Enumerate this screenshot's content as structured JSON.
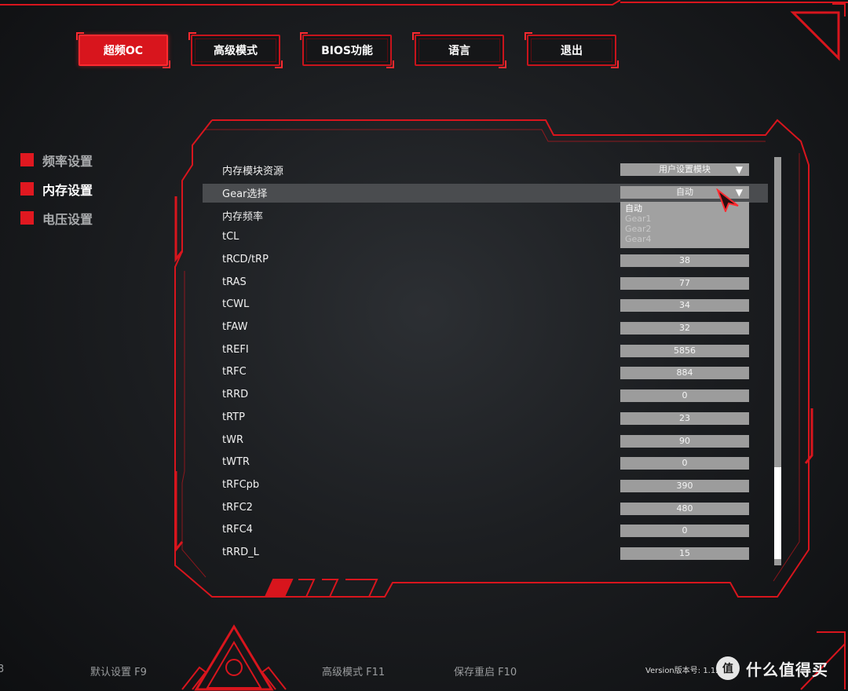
{
  "top_nav": {
    "items": [
      {
        "label": "超频OC",
        "active": true
      },
      {
        "label": "高级模式",
        "active": false
      },
      {
        "label": "BIOS功能",
        "active": false
      },
      {
        "label": "语言",
        "active": false
      },
      {
        "label": "退出",
        "active": false
      }
    ]
  },
  "sidebar": {
    "items": [
      {
        "label": "频率设置",
        "active": false
      },
      {
        "label": "内存设置",
        "active": true
      },
      {
        "label": "电压设置",
        "active": false
      }
    ]
  },
  "settings": {
    "rows": [
      {
        "name": "内存模块资源",
        "value": "用户设置模块",
        "has_dropdown": true
      },
      {
        "name": "Gear选择",
        "value": "自动",
        "has_dropdown": true,
        "highlighted": true
      },
      {
        "name": "内存频率",
        "value": ""
      },
      {
        "name": "tCL",
        "value": ""
      },
      {
        "name": "tRCD/tRP",
        "value": "38"
      },
      {
        "name": "tRAS",
        "value": "77"
      },
      {
        "name": "tCWL",
        "value": "34"
      },
      {
        "name": "tFAW",
        "value": "32"
      },
      {
        "name": "tREFI",
        "value": "5856"
      },
      {
        "name": "tRFC",
        "value": "884"
      },
      {
        "name": "tRRD",
        "value": "0"
      },
      {
        "name": "tRTP",
        "value": "23"
      },
      {
        "name": "tWR",
        "value": "90"
      },
      {
        "name": "tWTR",
        "value": "0"
      },
      {
        "name": "tRFCpb",
        "value": "390"
      },
      {
        "name": "tRFC2",
        "value": "480"
      },
      {
        "name": "tRFC4",
        "value": "0"
      },
      {
        "name": "tRRD_L",
        "value": "15"
      }
    ],
    "gear_dropdown_options": [
      "自动",
      "Gear1",
      "Gear2",
      "Gear4"
    ],
    "gear_selected": "自动"
  },
  "footer": {
    "left_fragment": "3",
    "default_settings": "默认设置 F9",
    "advanced_mode": "高级模式 F11",
    "save_restart": "保存重启 F10",
    "version": "Version版本号: 1.12"
  },
  "watermark": {
    "icon_text": "值",
    "text": "什么值得买"
  },
  "colors": {
    "accent_red": "#e01820",
    "field_gray": "#9c9c9c",
    "highlight_row": "#4a4c4f"
  },
  "icons": {
    "dropdown_arrow": "triangle-down-icon",
    "mouse_cursor": "cursor-arrow-icon"
  }
}
